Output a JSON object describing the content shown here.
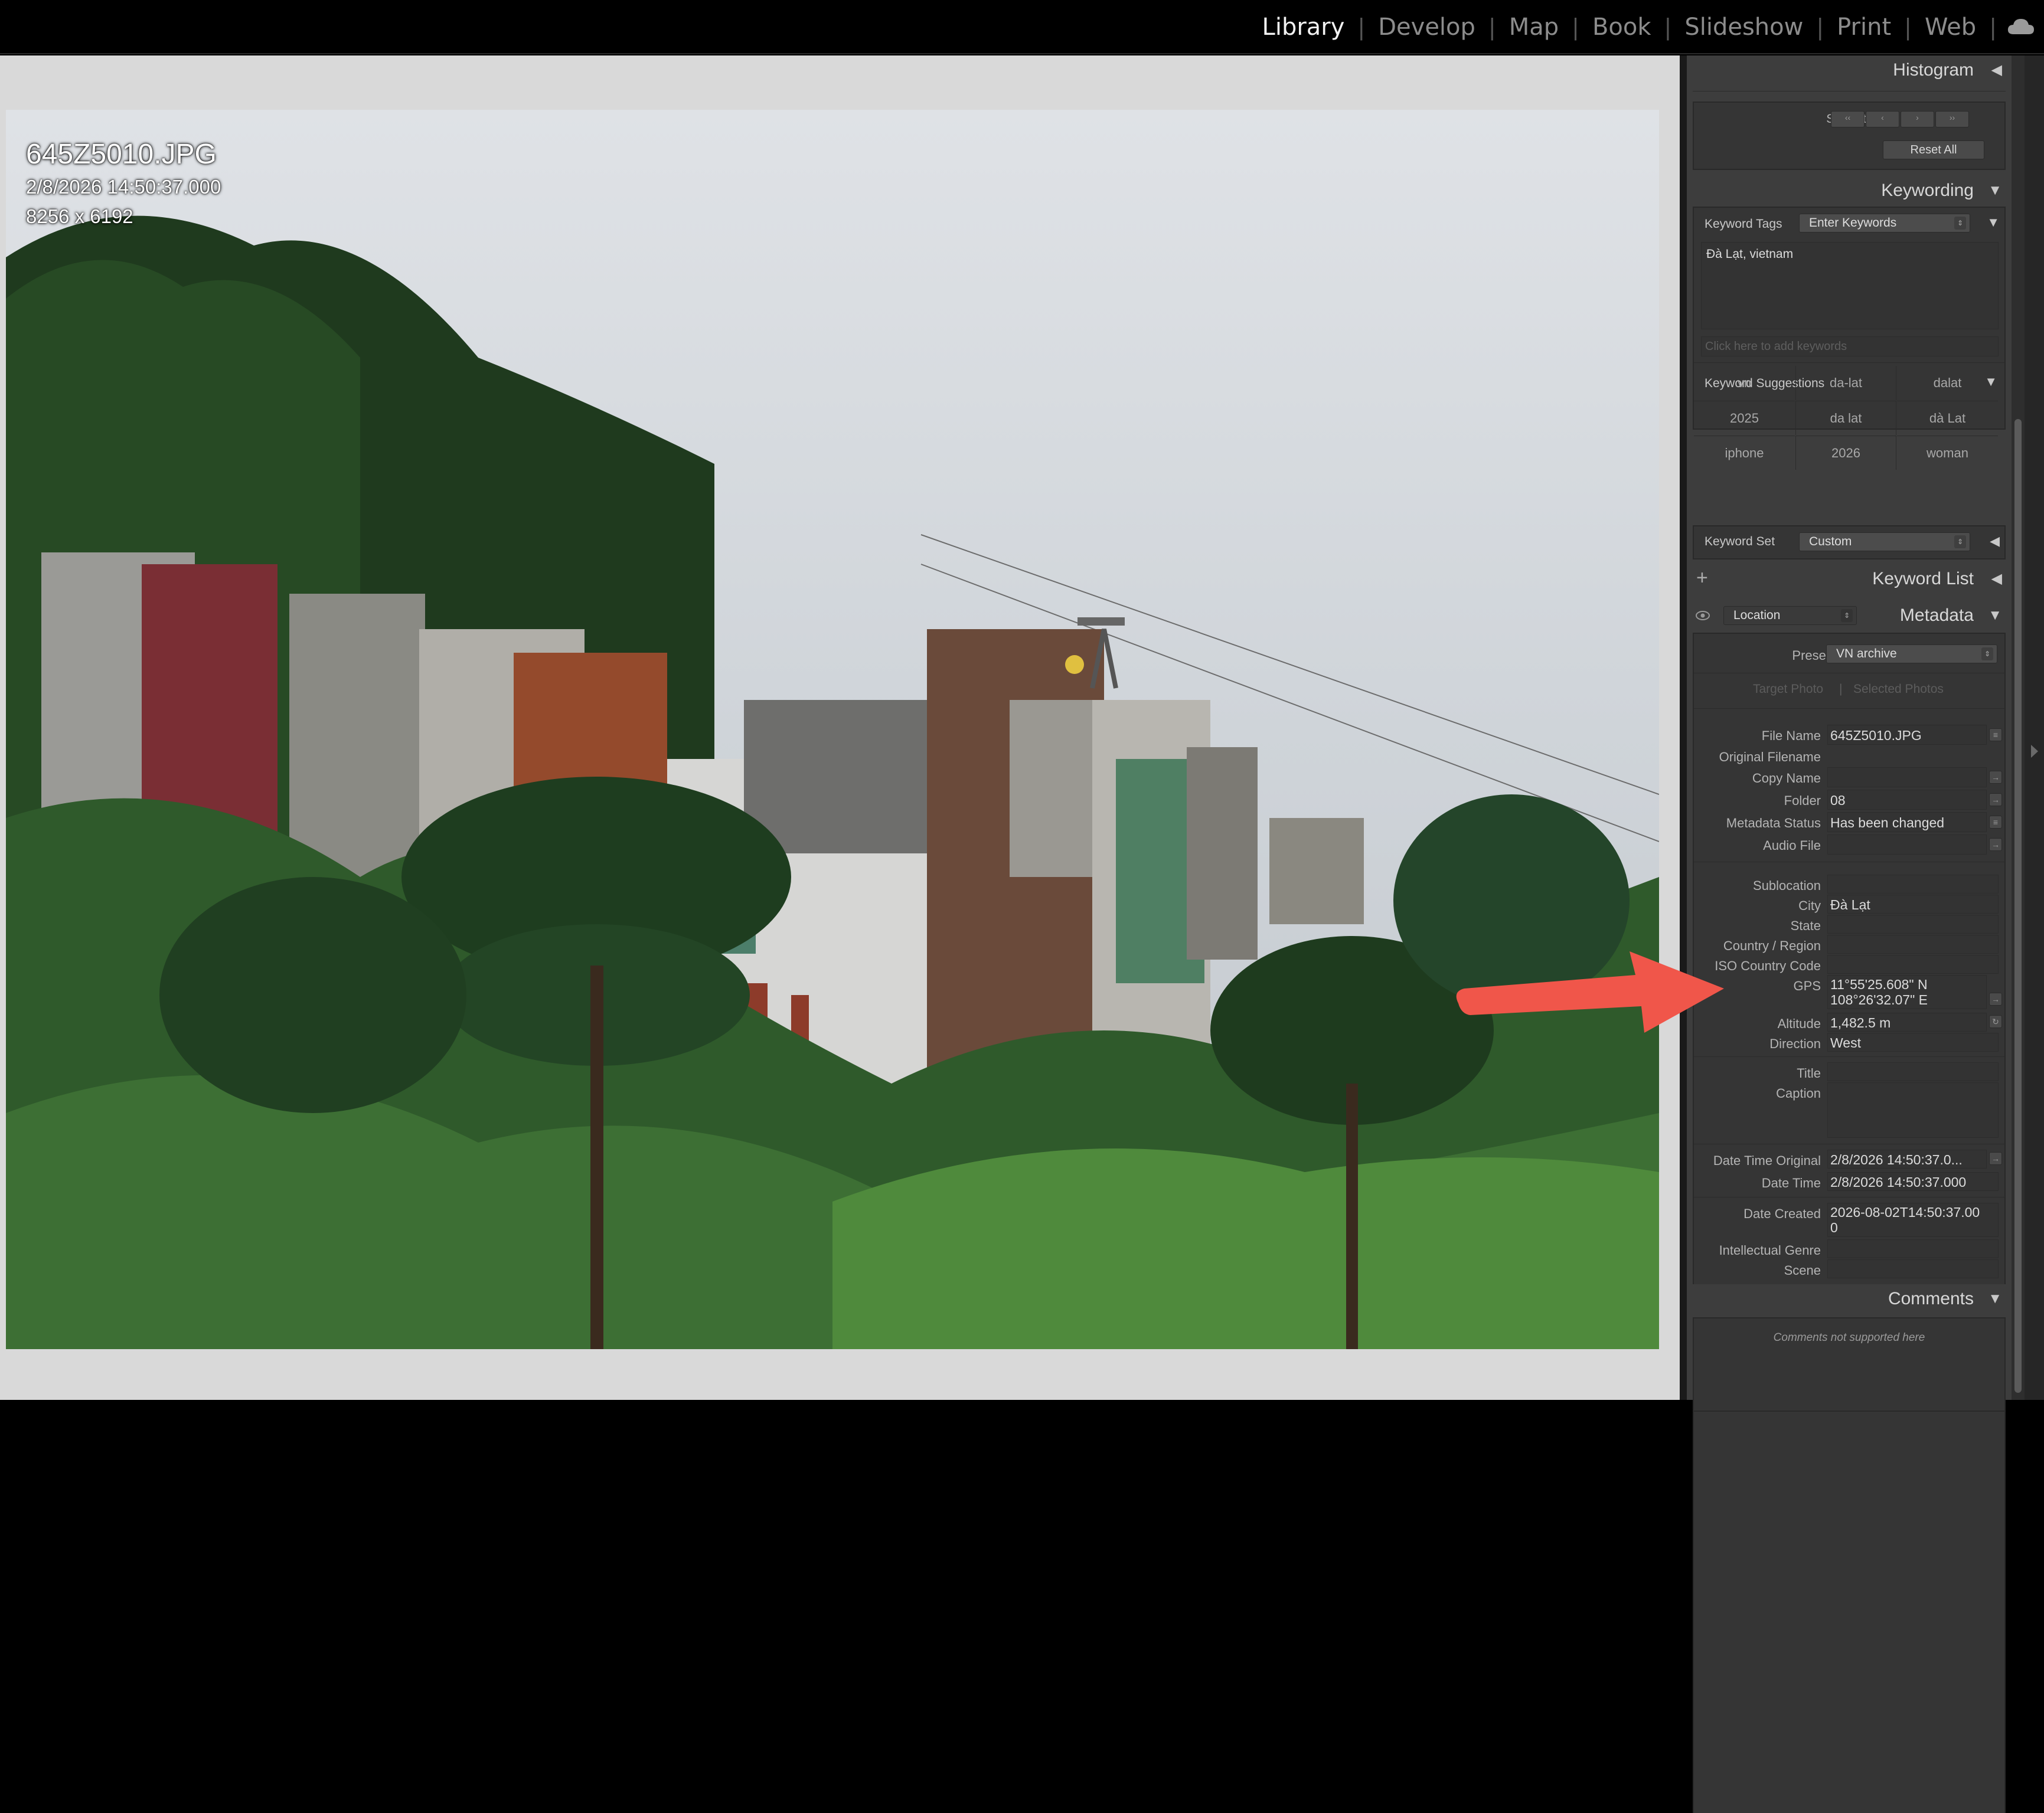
{
  "topbar": {
    "modules": [
      "Library",
      "Develop",
      "Map",
      "Book",
      "Slideshow",
      "Print",
      "Web"
    ],
    "active": "Library",
    "cloud_icon": "cloud-icon"
  },
  "overlay": {
    "filename": "645Z5010.JPG",
    "datetime": "2/8/2026 14:50:37.000",
    "dimensions": "8256 x 6192"
  },
  "histogram": {
    "title": "Histogram",
    "saturation_label": "Saturation",
    "reset_label": "Reset All"
  },
  "keywording": {
    "title": "Keywording",
    "tags_label": "Keyword Tags",
    "tags_mode": "Enter Keywords",
    "keywords_text": "Đà Lạt, vietnam",
    "add_placeholder": "Click here to add keywords",
    "suggestions_label": "Keyword Suggestions",
    "suggestions": [
      "vn",
      "da-lat",
      "dalat",
      "2025",
      "da lat",
      "dà Lat",
      "iphone",
      "2026",
      "woman"
    ],
    "set_label": "Keyword Set",
    "set_value": "Custom"
  },
  "keyword_list": {
    "title": "Keyword List",
    "add": "+"
  },
  "metadata": {
    "title": "Metadata",
    "view_value": "Location",
    "preset_label": "Preset",
    "preset_value": "VN archive",
    "target_photo": "Target Photo",
    "selected_photos": "Selected Photos",
    "group1": [
      {
        "label": "File Name",
        "value": "645Z5010.JPG"
      },
      {
        "label": "Original Filename",
        "value": ""
      },
      {
        "label": "Copy Name",
        "value": ""
      },
      {
        "label": "Folder",
        "value": "08"
      },
      {
        "label": "Metadata Status",
        "value": "Has been changed"
      },
      {
        "label": "Audio File",
        "value": ""
      }
    ],
    "group2": [
      {
        "label": "Sublocation",
        "value": ""
      },
      {
        "label": "City",
        "value": "Đà Lạt"
      },
      {
        "label": "State",
        "value": ""
      },
      {
        "label": "Country / Region",
        "value": ""
      },
      {
        "label": "ISO Country Code",
        "value": ""
      }
    ],
    "gps_label": "GPS",
    "gps_lat": "11°55'25.608\" N",
    "gps_lon": "108°26'32.07\" E",
    "altitude_label": "Altitude",
    "altitude_value": "1,482.5 m",
    "direction_label": "Direction",
    "direction_value": "West",
    "title_label": "Title",
    "caption_label": "Caption",
    "dto_label": "Date Time Original",
    "dto_value": "2/8/2026 14:50:37.0...",
    "dt_label": "Date Time",
    "dt_value": "2/8/2026 14:50:37.000",
    "created_label": "Date Created",
    "created_value_1": "2026-08-02T14:50:37.00",
    "created_value_2": "0",
    "genre_label": "Intellectual Genre",
    "scene_label": "Scene"
  },
  "comments": {
    "title": "Comments",
    "note": "Comments not supported here"
  },
  "colors": {
    "annotation_arrow": "#f0564a",
    "panel_bg": "#3d3d3d",
    "viewer_bg": "#d9d9d9"
  }
}
